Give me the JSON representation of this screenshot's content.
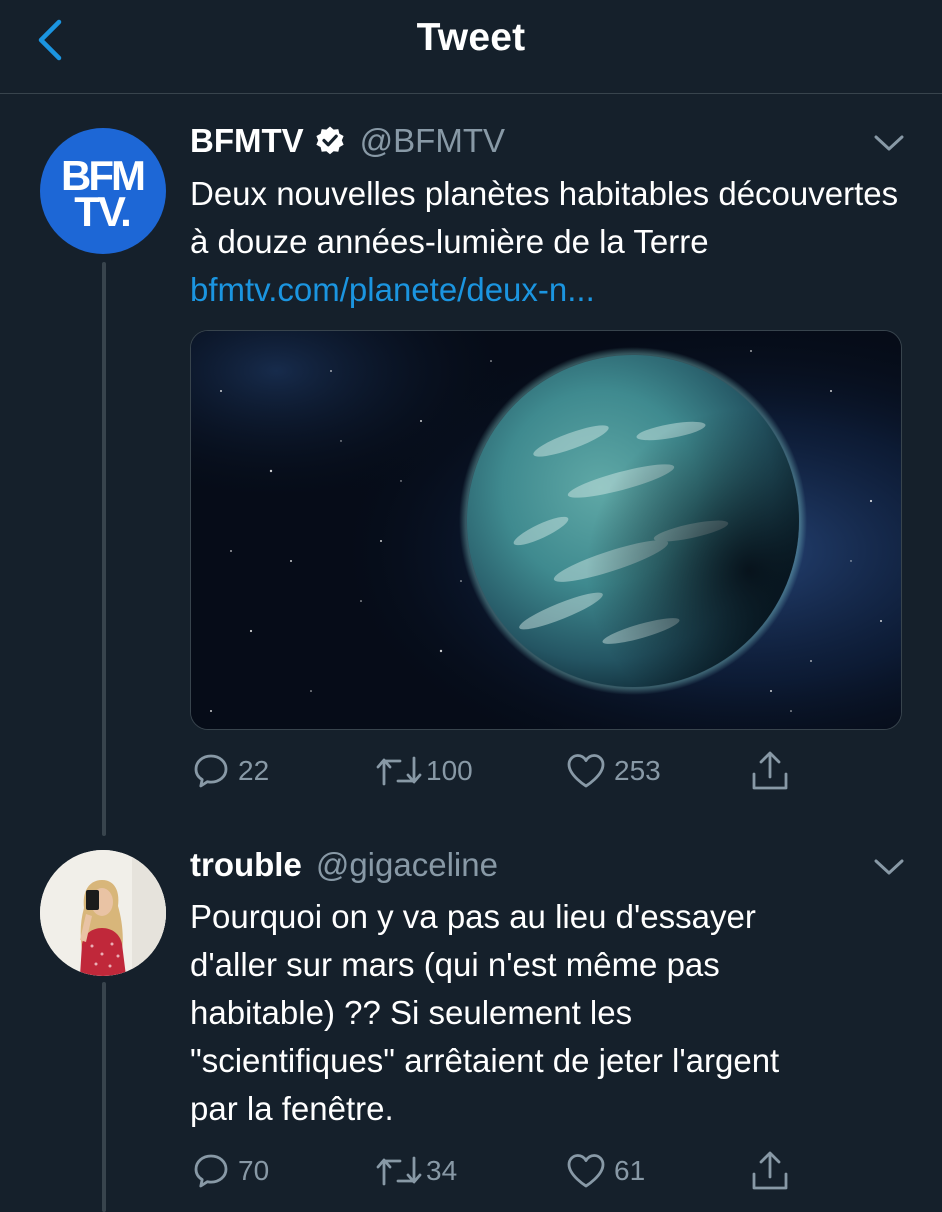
{
  "header": {
    "title": "Tweet"
  },
  "tweets": [
    {
      "avatar_text": [
        "BFM",
        "TV."
      ],
      "display_name": "BFMTV",
      "handle": "@BFMTV",
      "verified": true,
      "text": "Deux nouvelles planètes habitables découvertes à douze années-lumière de la Terre ",
      "link": "bfmtv.com/planete/deux-n...",
      "media": "exoplanet-image",
      "replies": "22",
      "retweets": "100",
      "likes": "253"
    },
    {
      "display_name": "trouble",
      "handle": "@gigaceline",
      "verified": false,
      "text_lines": [
        "Pourquoi on y va pas au lieu d'essayer",
        "d'aller sur mars (qui n'est même pas",
        "habitable) ?? Si seulement les",
        "\"scientifiques\" arrêtaient de jeter l'argent",
        "par la fenêtre."
      ],
      "replies": "70",
      "retweets": "34",
      "likes": "61"
    }
  ],
  "colors": {
    "background": "#15202b",
    "accent": "#1b95e0",
    "secondary_text": "#8899a6",
    "divider": "#38444d",
    "bfm_blue": "#1d67d6"
  }
}
